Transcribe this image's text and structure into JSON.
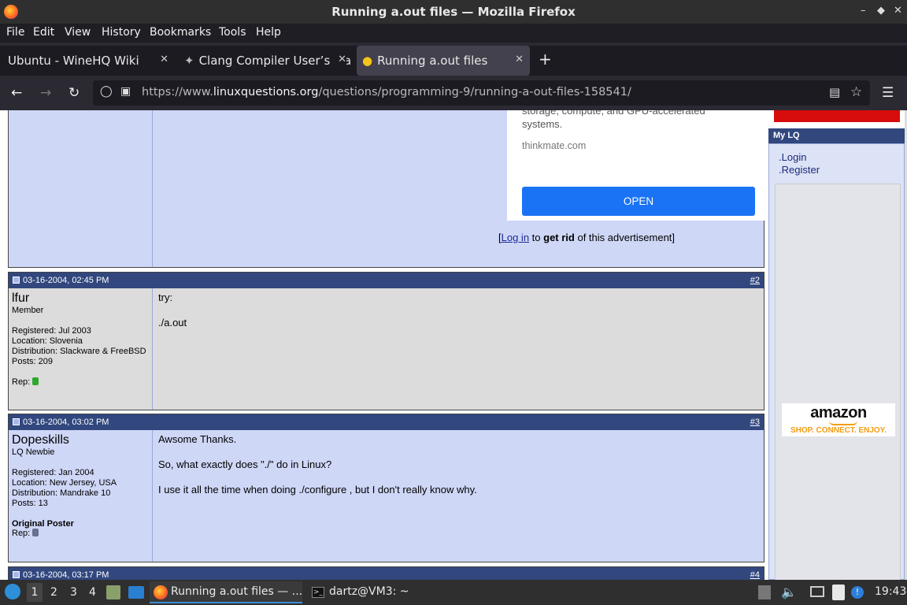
{
  "window": {
    "title": "Running a.out files — Mozilla Firefox"
  },
  "menu": [
    "File",
    "Edit",
    "View",
    "History",
    "Bookmarks",
    "Tools",
    "Help"
  ],
  "tabs": [
    {
      "label": "Ubuntu - WineHQ Wiki"
    },
    {
      "label": "Clang Compiler User’s Ma"
    },
    {
      "label": "Running a.out files"
    }
  ],
  "url": {
    "pre": "https://www.",
    "domain": "linuxquestions.org",
    "path": "/questions/programming-9/running-a-out-files-158541/"
  },
  "ad": {
    "text": "storage, compute, and GPU-accelerated\nsystems.",
    "domain": "thinkmate.com",
    "button": "OPEN",
    "footer_login": "Log in",
    "footer_to": " to ",
    "footer_rid": "get rid",
    "footer_rest": " of this advertisement"
  },
  "posts": [
    {
      "date": "03-16-2004, 02:45 PM",
      "num": "#2",
      "user": "lfur",
      "rank": "Member",
      "registered": "Registered: Jul 2003",
      "location": "Location: Slovenia",
      "distribution": "Distribution: Slackware & FreeBSD",
      "posts": "Posts: 209",
      "op": "",
      "rep": "Rep:",
      "message": "try:\n\n./a.out"
    },
    {
      "date": "03-16-2004, 03:02 PM",
      "num": "#3",
      "user": "Dopeskills",
      "rank": "LQ Newbie",
      "registered": "Registered: Jan 2004",
      "location": "Location: New Jersey, USA",
      "distribution": "Distribution: Mandrake 10",
      "posts": "Posts: 13",
      "op": "Original Poster",
      "rep": "Rep:",
      "message": "Awsome Thanks.\n\nSo, what exactly does \"./\" do in Linux?\n\nI use it all the time when doing ./configure , but I don't really know why."
    },
    {
      "date": "03-16-2004, 03:17 PM",
      "num": "#4"
    }
  ],
  "sidebar": {
    "mylq": "My LQ",
    "links": [
      "Login",
      "Register"
    ],
    "amazon": {
      "brand": "amazon",
      "tagline": "SHOP. CONNECT. ENJOY."
    }
  },
  "taskbar": {
    "workspaces": [
      "1",
      "2",
      "3",
      "4"
    ],
    "apps": [
      "Running a.out files — ...",
      "dartz@VM3: ~"
    ],
    "clock": "19:43"
  }
}
